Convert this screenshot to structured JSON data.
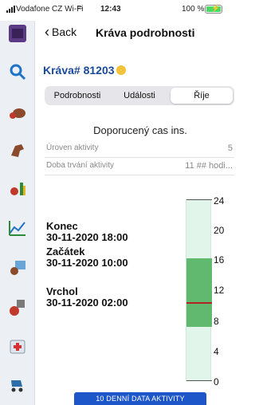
{
  "status_bar": {
    "carrier": "Vodafone CZ Wi-Fi",
    "time": "12:43",
    "battery": "100 %"
  },
  "sidebar": {
    "items": [
      {
        "icon": "app-logo-icon"
      },
      {
        "icon": "search-icon"
      },
      {
        "icon": "cow-icon"
      },
      {
        "icon": "horse-icon"
      },
      {
        "icon": "cow-growth-icon"
      },
      {
        "icon": "chart-icon"
      },
      {
        "icon": "cow-image-icon"
      },
      {
        "icon": "calendar-cow-icon"
      },
      {
        "icon": "medical-kit-icon"
      },
      {
        "icon": "stroller-icon"
      }
    ]
  },
  "navbar": {
    "back_label": "Back",
    "title": "Kráva podrobnosti"
  },
  "cow": {
    "title": "Kráva# 81203"
  },
  "tabs": [
    {
      "label": "Podrobnosti",
      "selected": false
    },
    {
      "label": "Události",
      "selected": false
    },
    {
      "label": "Říje",
      "selected": true
    }
  ],
  "section": {
    "title": "Doporucený cas ins.",
    "rows": [
      {
        "label": "Úroven aktivity",
        "value": "5"
      },
      {
        "label": "Doba trvání aktivity",
        "value": "11 ## hodi..."
      }
    ]
  },
  "events": [
    {
      "label": "Konec",
      "date": "30-11-2020 18:00"
    },
    {
      "label": "Začátek",
      "date": "30-11-2020 10:00"
    },
    {
      "label": "Vrchol",
      "date": "30-11-2020 02:00"
    }
  ],
  "gauge": {
    "scale_min": 0,
    "scale_max": 24,
    "ticks": [
      "24",
      "20",
      "16",
      "12",
      "8",
      "4",
      "0"
    ],
    "band_from": 7.2,
    "band_to": 16.2,
    "marker": 10.3,
    "colors": {
      "track": "#e2f5ea",
      "band": "#60b96e",
      "marker": "#b22222"
    }
  },
  "footer": {
    "button_label": "10 DENNÍ DATA AKTIVITY"
  }
}
